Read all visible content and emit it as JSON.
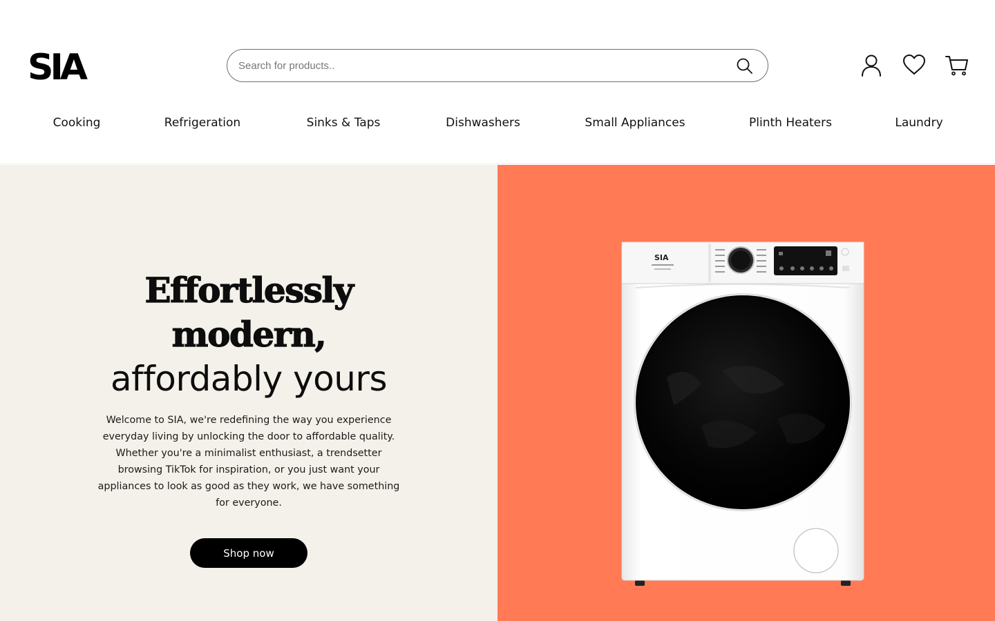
{
  "brand": {
    "logo_text": "SIA"
  },
  "search": {
    "placeholder": "Search for products.."
  },
  "header_icons": [
    "account-icon",
    "wishlist-heart-icon",
    "cart-icon"
  ],
  "nav": {
    "items": [
      {
        "label": "Cooking"
      },
      {
        "label": "Refrigeration"
      },
      {
        "label": "Sinks & Taps"
      },
      {
        "label": "Dishwashers"
      },
      {
        "label": "Small Appliances"
      },
      {
        "label": "Plinth Heaters"
      },
      {
        "label": "Laundry"
      }
    ]
  },
  "hero": {
    "headline_line1": "Effortlessly",
    "headline_line2": "modern,",
    "headline_line3": "affordably yours",
    "body": "Welcome to SIA, we're redefining the way you experience everyday living by unlocking the door to affordable quality. Whether you're a minimalist enthusiast, a trendsetter browsing TikTok for inspiration, or you just want your appliances to look as good as they work, we have something for everyone.",
    "cta_label": "Shop now",
    "product_image": "washing-machine",
    "colors": {
      "left_bg": "#f4f1ea",
      "right_bg": "#ff7a55",
      "cta_bg": "#000000"
    }
  }
}
